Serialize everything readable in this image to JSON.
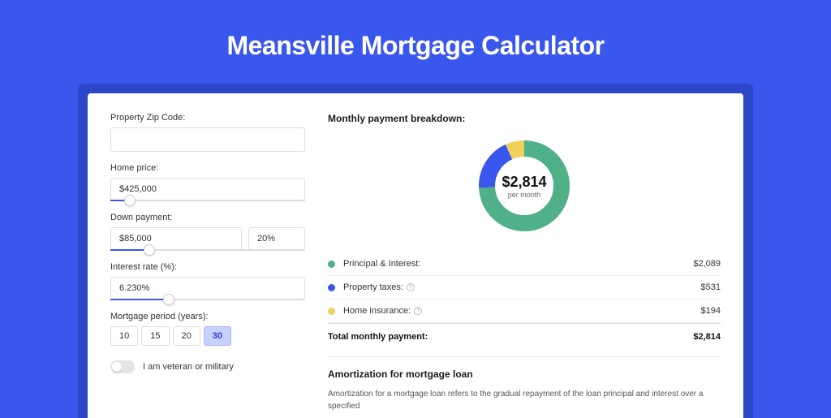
{
  "header": {
    "title": "Meansville Mortgage Calculator"
  },
  "form": {
    "zip_label": "Property Zip Code:",
    "zip_value": "",
    "home_price_label": "Home price:",
    "home_price_value": "$425,000",
    "home_price_slider_pct": 10,
    "down_payment_label": "Down payment:",
    "down_payment_value": "$85,000",
    "down_payment_pct_value": "20%",
    "dp_slider_pct": 20,
    "rate_label": "Interest rate (%):",
    "rate_value": "6.230%",
    "rate_slider_pct": 30,
    "period_label": "Mortgage period (years):",
    "periods": [
      "10",
      "15",
      "20",
      "30"
    ],
    "period_active": "30",
    "veteran_label": "I am veteran or military"
  },
  "breakdown": {
    "title": "Monthly payment breakdown:",
    "center_amount": "$2,814",
    "center_sub": "per month",
    "items": [
      {
        "label": "Principal & Interest:",
        "value": "$2,089",
        "color": "#4fb08a",
        "info": false,
        "pct": 74.2
      },
      {
        "label": "Property taxes:",
        "value": "$531",
        "color": "#3a57ed",
        "info": true,
        "pct": 18.9
      },
      {
        "label": "Home insurance:",
        "value": "$194",
        "color": "#f0cf5d",
        "info": true,
        "pct": 6.9
      }
    ],
    "total_label": "Total monthly payment:",
    "total_value": "$2,814"
  },
  "amort": {
    "title": "Amortization for mortgage loan",
    "text": "Amortization for a mortgage loan refers to the gradual repayment of the loan principal and interest over a specified"
  },
  "chart_data": {
    "type": "pie",
    "title": "Monthly payment breakdown",
    "series": [
      {
        "name": "Principal & Interest",
        "value": 2089,
        "color": "#4fb08a"
      },
      {
        "name": "Property taxes",
        "value": 531,
        "color": "#3a57ed"
      },
      {
        "name": "Home insurance",
        "value": 194,
        "color": "#f0cf5d"
      }
    ],
    "total": 2814,
    "unit": "USD per month"
  }
}
